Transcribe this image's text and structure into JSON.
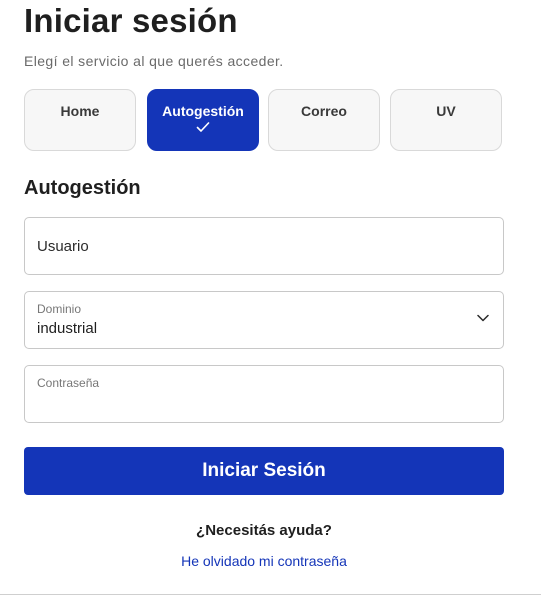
{
  "header": {
    "title": "Iniciar sesión",
    "subtitle": "Elegí el servicio al que querés acceder."
  },
  "services": {
    "items": [
      {
        "label": "Home",
        "selected": false
      },
      {
        "label": "Autogestión",
        "selected": true
      },
      {
        "label": "Correo",
        "selected": false
      },
      {
        "label": "UV",
        "selected": false
      }
    ],
    "selected_icon": "check-icon"
  },
  "form": {
    "section_title": "Autogestión",
    "username": {
      "placeholder": "Usuario",
      "value": ""
    },
    "domain": {
      "label": "Dominio",
      "value": "industrial",
      "icon": "chevron-down-icon"
    },
    "password": {
      "label": "Contraseña",
      "value": ""
    },
    "submit_label": "Iniciar Sesión"
  },
  "help": {
    "heading": "¿Necesitás ayuda?",
    "forgot_link": "He olvidado mi contraseña"
  },
  "colors": {
    "accent": "#1435b8",
    "tile_background": "#f7f7f7",
    "border": "#c8c8c8",
    "text": "#1f1f1f",
    "muted_text": "#6a6a6a"
  }
}
